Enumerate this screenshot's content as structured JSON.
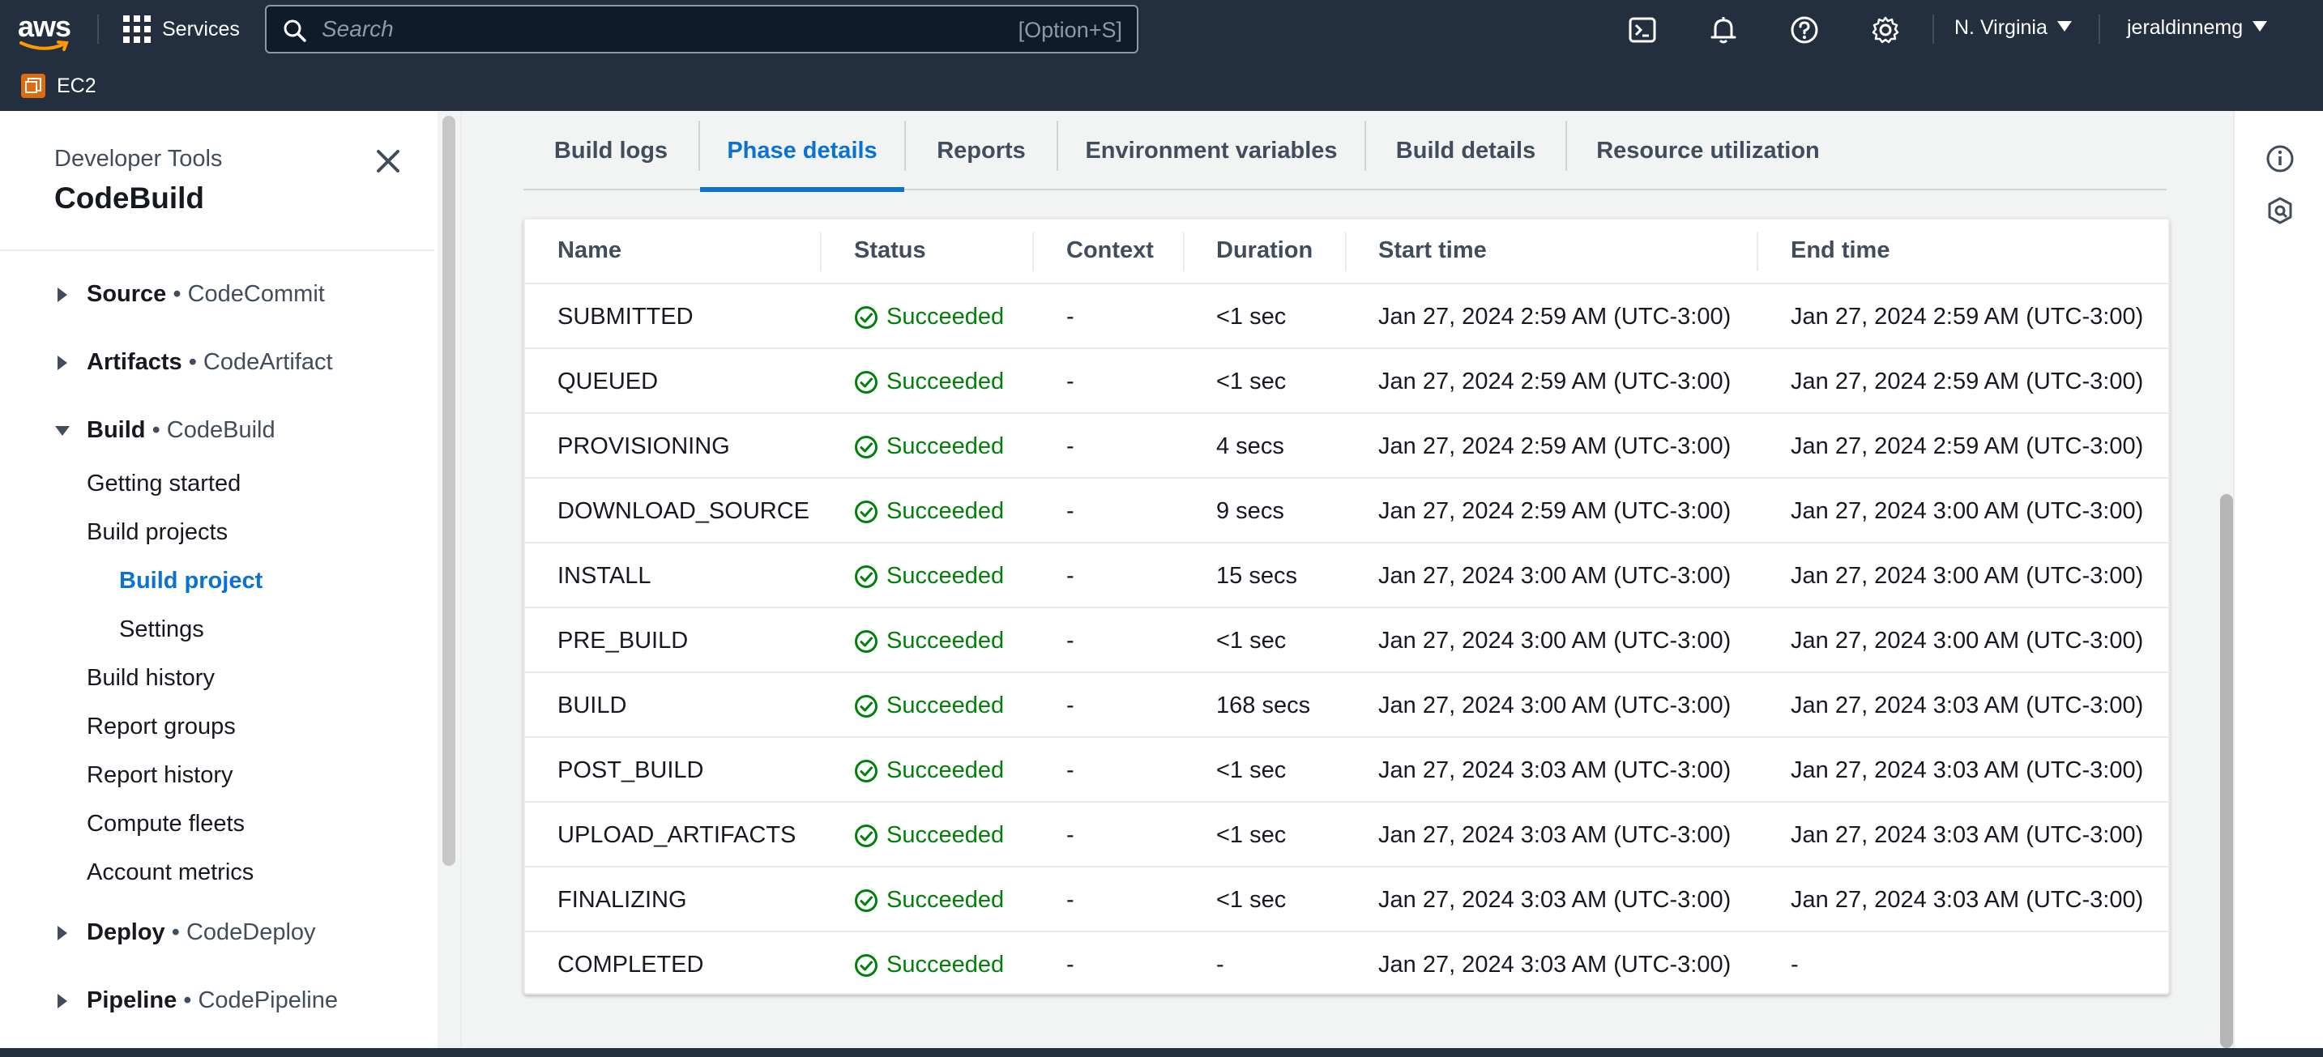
{
  "topnav": {
    "logo_text": "aws",
    "services_label": "Services",
    "search_placeholder": "Search",
    "search_shortcut": "[Option+S]",
    "region": "N. Virginia",
    "account": "jeraldinnemg",
    "favorite_service": "EC2",
    "icons": [
      "cloudshell-icon",
      "notifications-bell-icon",
      "help-icon",
      "settings-gear-icon"
    ]
  },
  "sidebar": {
    "tools_label": "Developer Tools",
    "product_title": "CodeBuild",
    "sections": [
      {
        "name": "Source",
        "service": "• CodeCommit",
        "expanded": false
      },
      {
        "name": "Artifacts",
        "service": "• CodeArtifact",
        "expanded": false
      },
      {
        "name": "Build",
        "service": "• CodeBuild",
        "expanded": true
      },
      {
        "name": "Deploy",
        "service": "• CodeDeploy",
        "expanded": false
      },
      {
        "name": "Pipeline",
        "service": "• CodePipeline",
        "expanded": false
      }
    ],
    "build_links": [
      "Getting started",
      "Build projects",
      "Build project",
      "Settings",
      "Build history",
      "Report groups",
      "Report history",
      "Compute fleets",
      "Account metrics"
    ],
    "active_link": "Build project"
  },
  "tabs": [
    "Build logs",
    "Phase details",
    "Reports",
    "Environment variables",
    "Build details",
    "Resource utilization"
  ],
  "active_tab": "Phase details",
  "table": {
    "headers": [
      "Name",
      "Status",
      "Context",
      "Duration",
      "Start time",
      "End time"
    ],
    "rows": [
      {
        "name": "SUBMITTED",
        "status": "Succeeded",
        "context": "-",
        "duration": "<1 sec",
        "start": "Jan 27, 2024 2:59 AM (UTC-3:00)",
        "end": "Jan 27, 2024 2:59 AM (UTC-3:00)"
      },
      {
        "name": "QUEUED",
        "status": "Succeeded",
        "context": "-",
        "duration": "<1 sec",
        "start": "Jan 27, 2024 2:59 AM (UTC-3:00)",
        "end": "Jan 27, 2024 2:59 AM (UTC-3:00)"
      },
      {
        "name": "PROVISIONING",
        "status": "Succeeded",
        "context": "-",
        "duration": "4 secs",
        "start": "Jan 27, 2024 2:59 AM (UTC-3:00)",
        "end": "Jan 27, 2024 2:59 AM (UTC-3:00)"
      },
      {
        "name": "DOWNLOAD_SOURCE",
        "status": "Succeeded",
        "context": "-",
        "duration": "9 secs",
        "start": "Jan 27, 2024 2:59 AM (UTC-3:00)",
        "end": "Jan 27, 2024 3:00 AM (UTC-3:00)"
      },
      {
        "name": "INSTALL",
        "status": "Succeeded",
        "context": "-",
        "duration": "15 secs",
        "start": "Jan 27, 2024 3:00 AM (UTC-3:00)",
        "end": "Jan 27, 2024 3:00 AM (UTC-3:00)"
      },
      {
        "name": "PRE_BUILD",
        "status": "Succeeded",
        "context": "-",
        "duration": "<1 sec",
        "start": "Jan 27, 2024 3:00 AM (UTC-3:00)",
        "end": "Jan 27, 2024 3:00 AM (UTC-3:00)"
      },
      {
        "name": "BUILD",
        "status": "Succeeded",
        "context": "-",
        "duration": "168 secs",
        "start": "Jan 27, 2024 3:00 AM (UTC-3:00)",
        "end": "Jan 27, 2024 3:03 AM (UTC-3:00)"
      },
      {
        "name": "POST_BUILD",
        "status": "Succeeded",
        "context": "-",
        "duration": "<1 sec",
        "start": "Jan 27, 2024 3:03 AM (UTC-3:00)",
        "end": "Jan 27, 2024 3:03 AM (UTC-3:00)"
      },
      {
        "name": "UPLOAD_ARTIFACTS",
        "status": "Succeeded",
        "context": "-",
        "duration": "<1 sec",
        "start": "Jan 27, 2024 3:03 AM (UTC-3:00)",
        "end": "Jan 27, 2024 3:03 AM (UTC-3:00)"
      },
      {
        "name": "FINALIZING",
        "status": "Succeeded",
        "context": "-",
        "duration": "<1 sec",
        "start": "Jan 27, 2024 3:03 AM (UTC-3:00)",
        "end": "Jan 27, 2024 3:03 AM (UTC-3:00)"
      },
      {
        "name": "COMPLETED",
        "status": "Succeeded",
        "context": "-",
        "duration": "-",
        "start": "Jan 27, 2024 3:03 AM (UTC-3:00)",
        "end": "-"
      }
    ]
  },
  "right_rail": {
    "icons": [
      "info-icon",
      "feedback-icon"
    ]
  },
  "colors": {
    "nav_bg": "#232f3e",
    "link_blue": "#0972d3",
    "success_green": "#037f0c",
    "ec2_orange": "#dd6b10"
  }
}
